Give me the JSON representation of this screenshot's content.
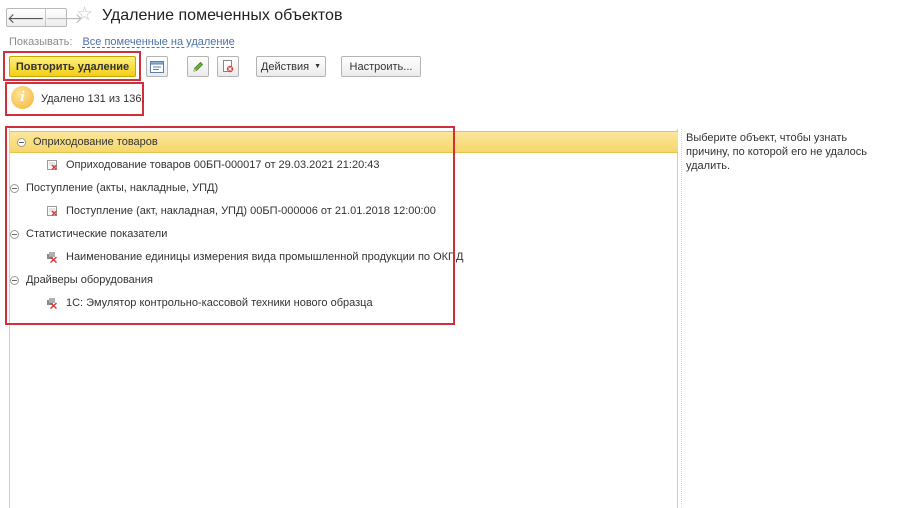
{
  "window": {
    "title": "Удаление помеченных объектов",
    "back_glyph": "🡐",
    "forward_glyph": "🡒",
    "star_glyph": "☆"
  },
  "show": {
    "label": "Показывать:",
    "link": "Все помеченные на удаление"
  },
  "toolbar": {
    "repeat_label": "Повторить удаление",
    "actions_label": "Действия",
    "configure_label": "Настроить...",
    "primary_color": "#f2cd19"
  },
  "info": {
    "icon_glyph": "i",
    "text": "Удалено 131 из 136."
  },
  "tree": {
    "groups": [
      {
        "label": "Оприходование товаров",
        "selected": true,
        "children": [
          {
            "label": "Оприходование товаров 00БП-000017 от 29.03.2021 21:20:43",
            "icon": "document-marked-icon"
          }
        ]
      },
      {
        "label": "Поступление (акты, накладные, УПД)",
        "selected": false,
        "children": [
          {
            "label": "Поступление (акт, накладная, УПД) 00БП-000006 от 21.01.2018 12:00:00",
            "icon": "document-marked-icon"
          }
        ]
      },
      {
        "label": "Статистические показатели",
        "selected": false,
        "children": [
          {
            "label": "Наименование единицы измерения вида промышленной продукции по ОКПД",
            "icon": "catalog-marked-icon"
          }
        ]
      },
      {
        "label": "Драйверы оборудования",
        "selected": false,
        "children": [
          {
            "label": "1С: Эмулятор контрольно-кассовой техники нового образца",
            "icon": "catalog-marked-icon"
          }
        ]
      }
    ]
  },
  "hint": {
    "text": "Выберите объект, чтобы узнать причину, по которой его не удалось удалить."
  },
  "colors": {
    "highlight_frame": "#d0303a",
    "selected_row": "#f6d76a",
    "link": "#4e73a6"
  }
}
